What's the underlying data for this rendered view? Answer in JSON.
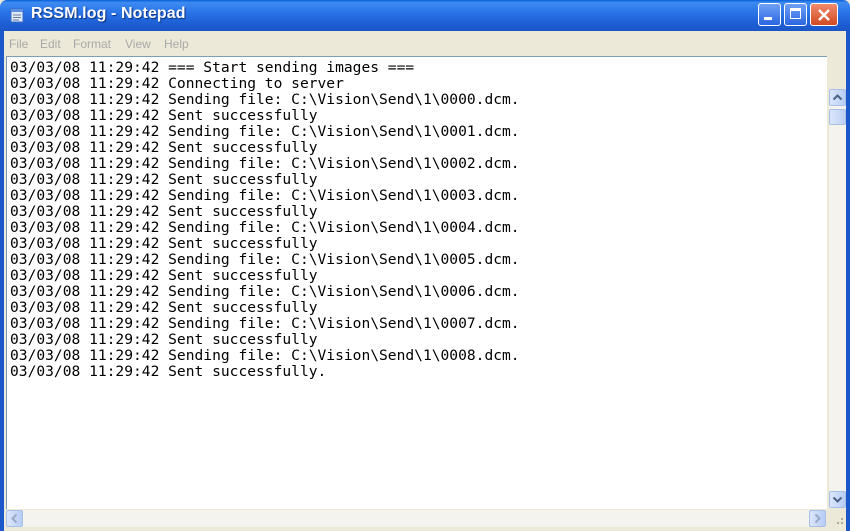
{
  "window": {
    "title": "RSSM.log - Notepad"
  },
  "menu": {
    "items": [
      "File",
      "Edit",
      "Format",
      "View",
      "Help"
    ]
  },
  "document": {
    "lines": [
      "03/03/08 11:29:42 === Start sending images ===",
      "03/03/08 11:29:42 Connecting to server",
      "03/03/08 11:29:42 Sending file: C:\\Vision\\Send\\1\\0000.dcm.",
      "03/03/08 11:29:42 Sent successfully",
      "03/03/08 11:29:42 Sending file: C:\\Vision\\Send\\1\\0001.dcm.",
      "03/03/08 11:29:42 Sent successfully",
      "03/03/08 11:29:42 Sending file: C:\\Vision\\Send\\1\\0002.dcm.",
      "03/03/08 11:29:42 Sent successfully",
      "03/03/08 11:29:42 Sending file: C:\\Vision\\Send\\1\\0003.dcm.",
      "03/03/08 11:29:42 Sent successfully",
      "03/03/08 11:29:42 Sending file: C:\\Vision\\Send\\1\\0004.dcm.",
      "03/03/08 11:29:42 Sent successfully",
      "03/03/08 11:29:42 Sending file: C:\\Vision\\Send\\1\\0005.dcm.",
      "03/03/08 11:29:42 Sent successfully",
      "03/03/08 11:29:42 Sending file: C:\\Vision\\Send\\1\\0006.dcm.",
      "03/03/08 11:29:42 Sent successfully",
      "03/03/08 11:29:42 Sending file: C:\\Vision\\Send\\1\\0007.dcm.",
      "03/03/08 11:29:42 Sent successfully",
      "03/03/08 11:29:42 Sending file: C:\\Vision\\Send\\1\\0008.dcm.",
      "03/03/08 11:29:42 Sent successfully."
    ]
  },
  "icons": {
    "app": "notepad-icon",
    "minimize": "minimize-icon",
    "maximize": "maximize-icon",
    "close": "close-icon",
    "scroll_up": "chevron-up-icon",
    "scroll_down": "chevron-down-icon",
    "scroll_left": "chevron-left-icon",
    "scroll_right": "chevron-right-icon"
  },
  "colors": {
    "titlebar": "#2a74e8",
    "close_button": "#d24a22",
    "menu_text_disabled": "#a9a9a9"
  }
}
